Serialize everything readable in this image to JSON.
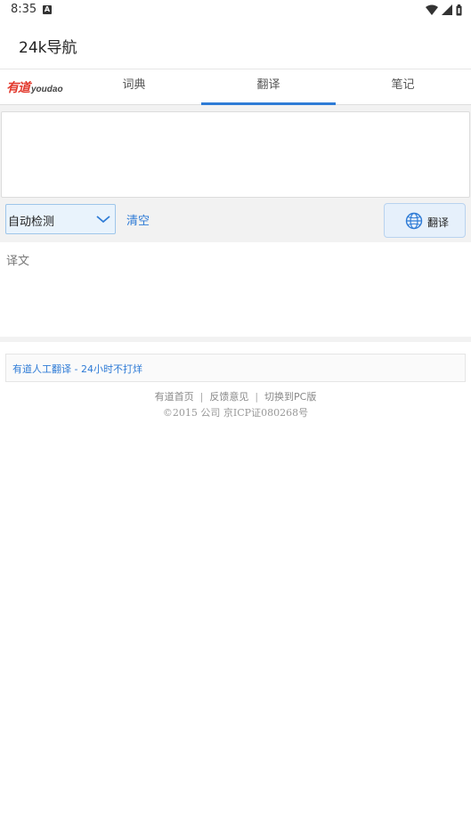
{
  "status_bar": {
    "time": "8:35",
    "notification_icon": "A"
  },
  "app_bar": {
    "title": "24k导航"
  },
  "header": {
    "logo_cn": "有道",
    "logo_en": "youdao",
    "tabs": [
      {
        "label": "词典",
        "active": false
      },
      {
        "label": "翻译",
        "active": true
      },
      {
        "label": "笔记",
        "active": false
      }
    ]
  },
  "translator": {
    "source_value": "",
    "language_select": "自动检测",
    "clear_label": "清空",
    "translate_button": "翻译",
    "result_label": "译文"
  },
  "promo": {
    "text": "有道人工翻译 - 24小时不打烊"
  },
  "footer": {
    "links": [
      "有道首页",
      "反馈意见",
      "切换到PC版"
    ],
    "separator": "|",
    "copyright": "©2015 公司 京ICP证080268号"
  },
  "colors": {
    "accent": "#2e7bd6",
    "logo_red": "#e23a2e",
    "band_gray": "#f2f2f2"
  }
}
